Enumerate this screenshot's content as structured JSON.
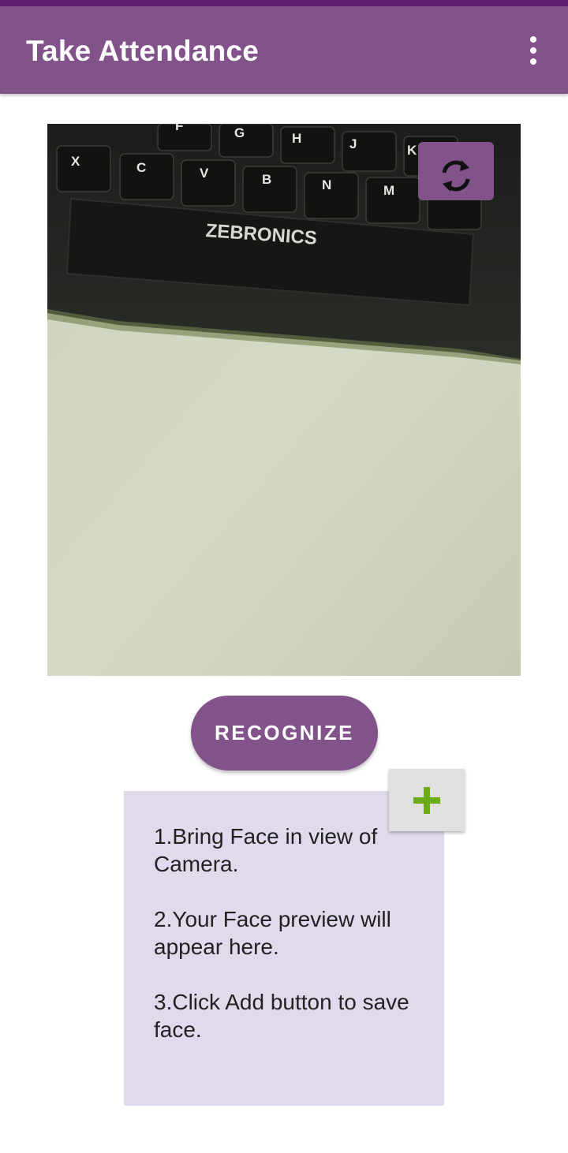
{
  "app_bar": {
    "title": "Take Attendance",
    "menu_icon": "more-vert-icon"
  },
  "camera": {
    "switch_icon": "switch-camera-icon",
    "keyboard_brand": "ZEBRONICS",
    "keys": [
      "X",
      "C",
      "V",
      "B",
      "N",
      "M",
      "G",
      "H",
      "J",
      "K",
      "F"
    ]
  },
  "recognize": {
    "label": "RECOGNIZE"
  },
  "face_preview": {
    "add_icon": "add-plus-icon",
    "instructions": [
      "1.Bring Face in view of Camera.",
      "2.Your Face preview will appear here.",
      "3.Click Add button to save face."
    ]
  },
  "colors": {
    "primary": "#82538a",
    "status_bar": "#5f1f6f",
    "preview_bg": "#e1daed",
    "add_icon": "#6aab16"
  }
}
